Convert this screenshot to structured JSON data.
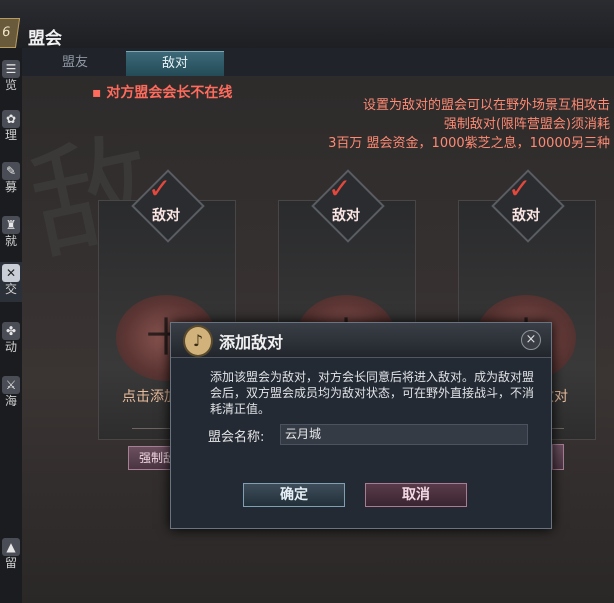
{
  "window": {
    "title": "盟会",
    "emblem": "6"
  },
  "sidebar": {
    "items": [
      {
        "label": "览",
        "icon": "list-icon"
      },
      {
        "label": "理",
        "icon": "paw-icon"
      },
      {
        "label": "募",
        "icon": "recruit-icon"
      },
      {
        "label": "就",
        "icon": "achievement-icon"
      },
      {
        "label": "交",
        "icon": "diplomacy-icon"
      },
      {
        "label": "动",
        "icon": "activity-icon"
      },
      {
        "label": "海",
        "icon": "sea-icon"
      }
    ],
    "bottom_label": "留"
  },
  "tabs": [
    {
      "label": "盟友"
    },
    {
      "label": "敌对"
    }
  ],
  "warning": "▪ 对方盟会会长不在线",
  "info_lines": [
    "设置为敌对的盟会可以在野外场景互相攻击",
    "强制敌对(限阵营盟会)须消耗",
    "3百万 盟会资金，1000紫芝之息，10000另三种"
  ],
  "slots": [
    {
      "label": "敌对"
    },
    {
      "label": "敌对"
    },
    {
      "label": "敌对"
    }
  ],
  "hint_left": "点击添加",
  "hint_right": "敌对",
  "force_button": "强制敌",
  "dialog": {
    "title": "添加敌对",
    "description": "添加该盟会为敌对，对方会长同意后将进入敌对。成为敌对盟会后，双方盟会成员均为敌对状态，可在野外直接战斗，不消耗清正值。",
    "field_label": "盟会名称:",
    "field_value": "云月城",
    "ok": "确定",
    "cancel": "取消",
    "close": "×"
  }
}
